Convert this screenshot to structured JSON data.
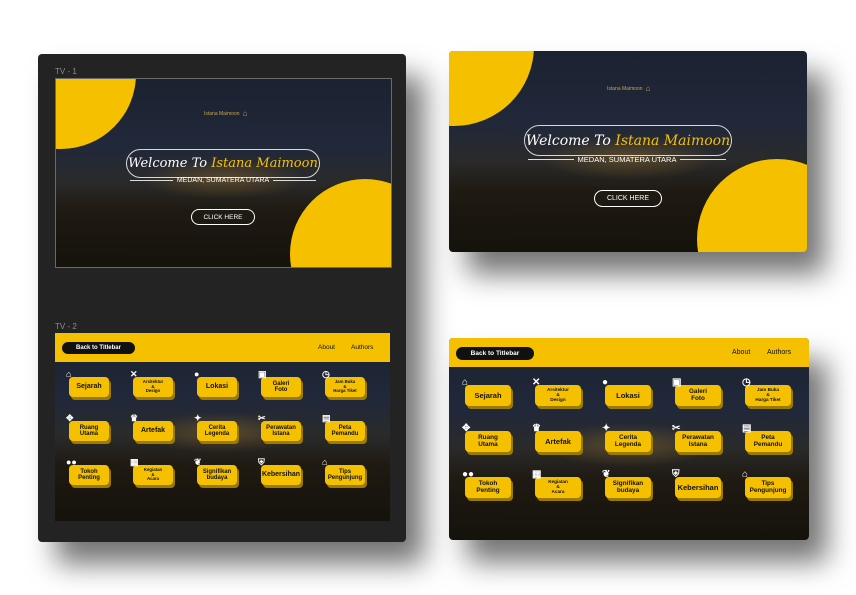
{
  "frames": {
    "tv1_label": "TV - 1",
    "tv2_label": "TV - 2"
  },
  "hero": {
    "logo_text": "Istana Maimoon",
    "welcome_prefix": "Welcome To ",
    "welcome_accent": "Istana Maimoon",
    "subtitle": "MEDAN, SUMATERA UTARA",
    "cta": "CLICK HERE"
  },
  "menu": {
    "back_label": "Back to Titlebar",
    "nav": [
      "About",
      "Authors"
    ],
    "tiles": [
      {
        "label": "Sejarah",
        "icon": "temple-icon",
        "glyph": "⌂"
      },
      {
        "label": "Arsitektur\n&\nDesign",
        "icon": "tools-icon",
        "glyph": "✕"
      },
      {
        "label": "Lokasi",
        "icon": "map-pin-icon",
        "glyph": "●"
      },
      {
        "label": "Galeri\nFoto",
        "icon": "photo-icon",
        "glyph": "▣"
      },
      {
        "label": "Jam Buka\n&\nHarga Tiket",
        "icon": "clock-icon",
        "glyph": "◷"
      },
      {
        "label": "Ruang\nUtama",
        "icon": "chandelier-icon",
        "glyph": "✥"
      },
      {
        "label": "Artefak",
        "icon": "crown-icon",
        "glyph": "♛"
      },
      {
        "label": "Cerita\nLegenda",
        "icon": "scroll-icon",
        "glyph": "✦"
      },
      {
        "label": "Perawatan\nIstana",
        "icon": "wrench-icon",
        "glyph": "✂"
      },
      {
        "label": "Peta\nPemandu",
        "icon": "map-icon",
        "glyph": "▤"
      },
      {
        "label": "Tokoh\nPenting",
        "icon": "people-icon",
        "glyph": "●●"
      },
      {
        "label": "Kegiatan\n&\nAcara",
        "icon": "calendar-icon",
        "glyph": "▦"
      },
      {
        "label": "Signifikan\nbudaya",
        "icon": "culture-icon",
        "glyph": "❦"
      },
      {
        "label": "Kebersihan",
        "icon": "shield-check-icon",
        "glyph": "⛨"
      },
      {
        "label": "Tips\nPengunjung",
        "icon": "house-icon",
        "glyph": "⌂"
      }
    ]
  },
  "colors": {
    "accent": "#f5c000",
    "canvas": "#232323",
    "dark": "#111111"
  }
}
